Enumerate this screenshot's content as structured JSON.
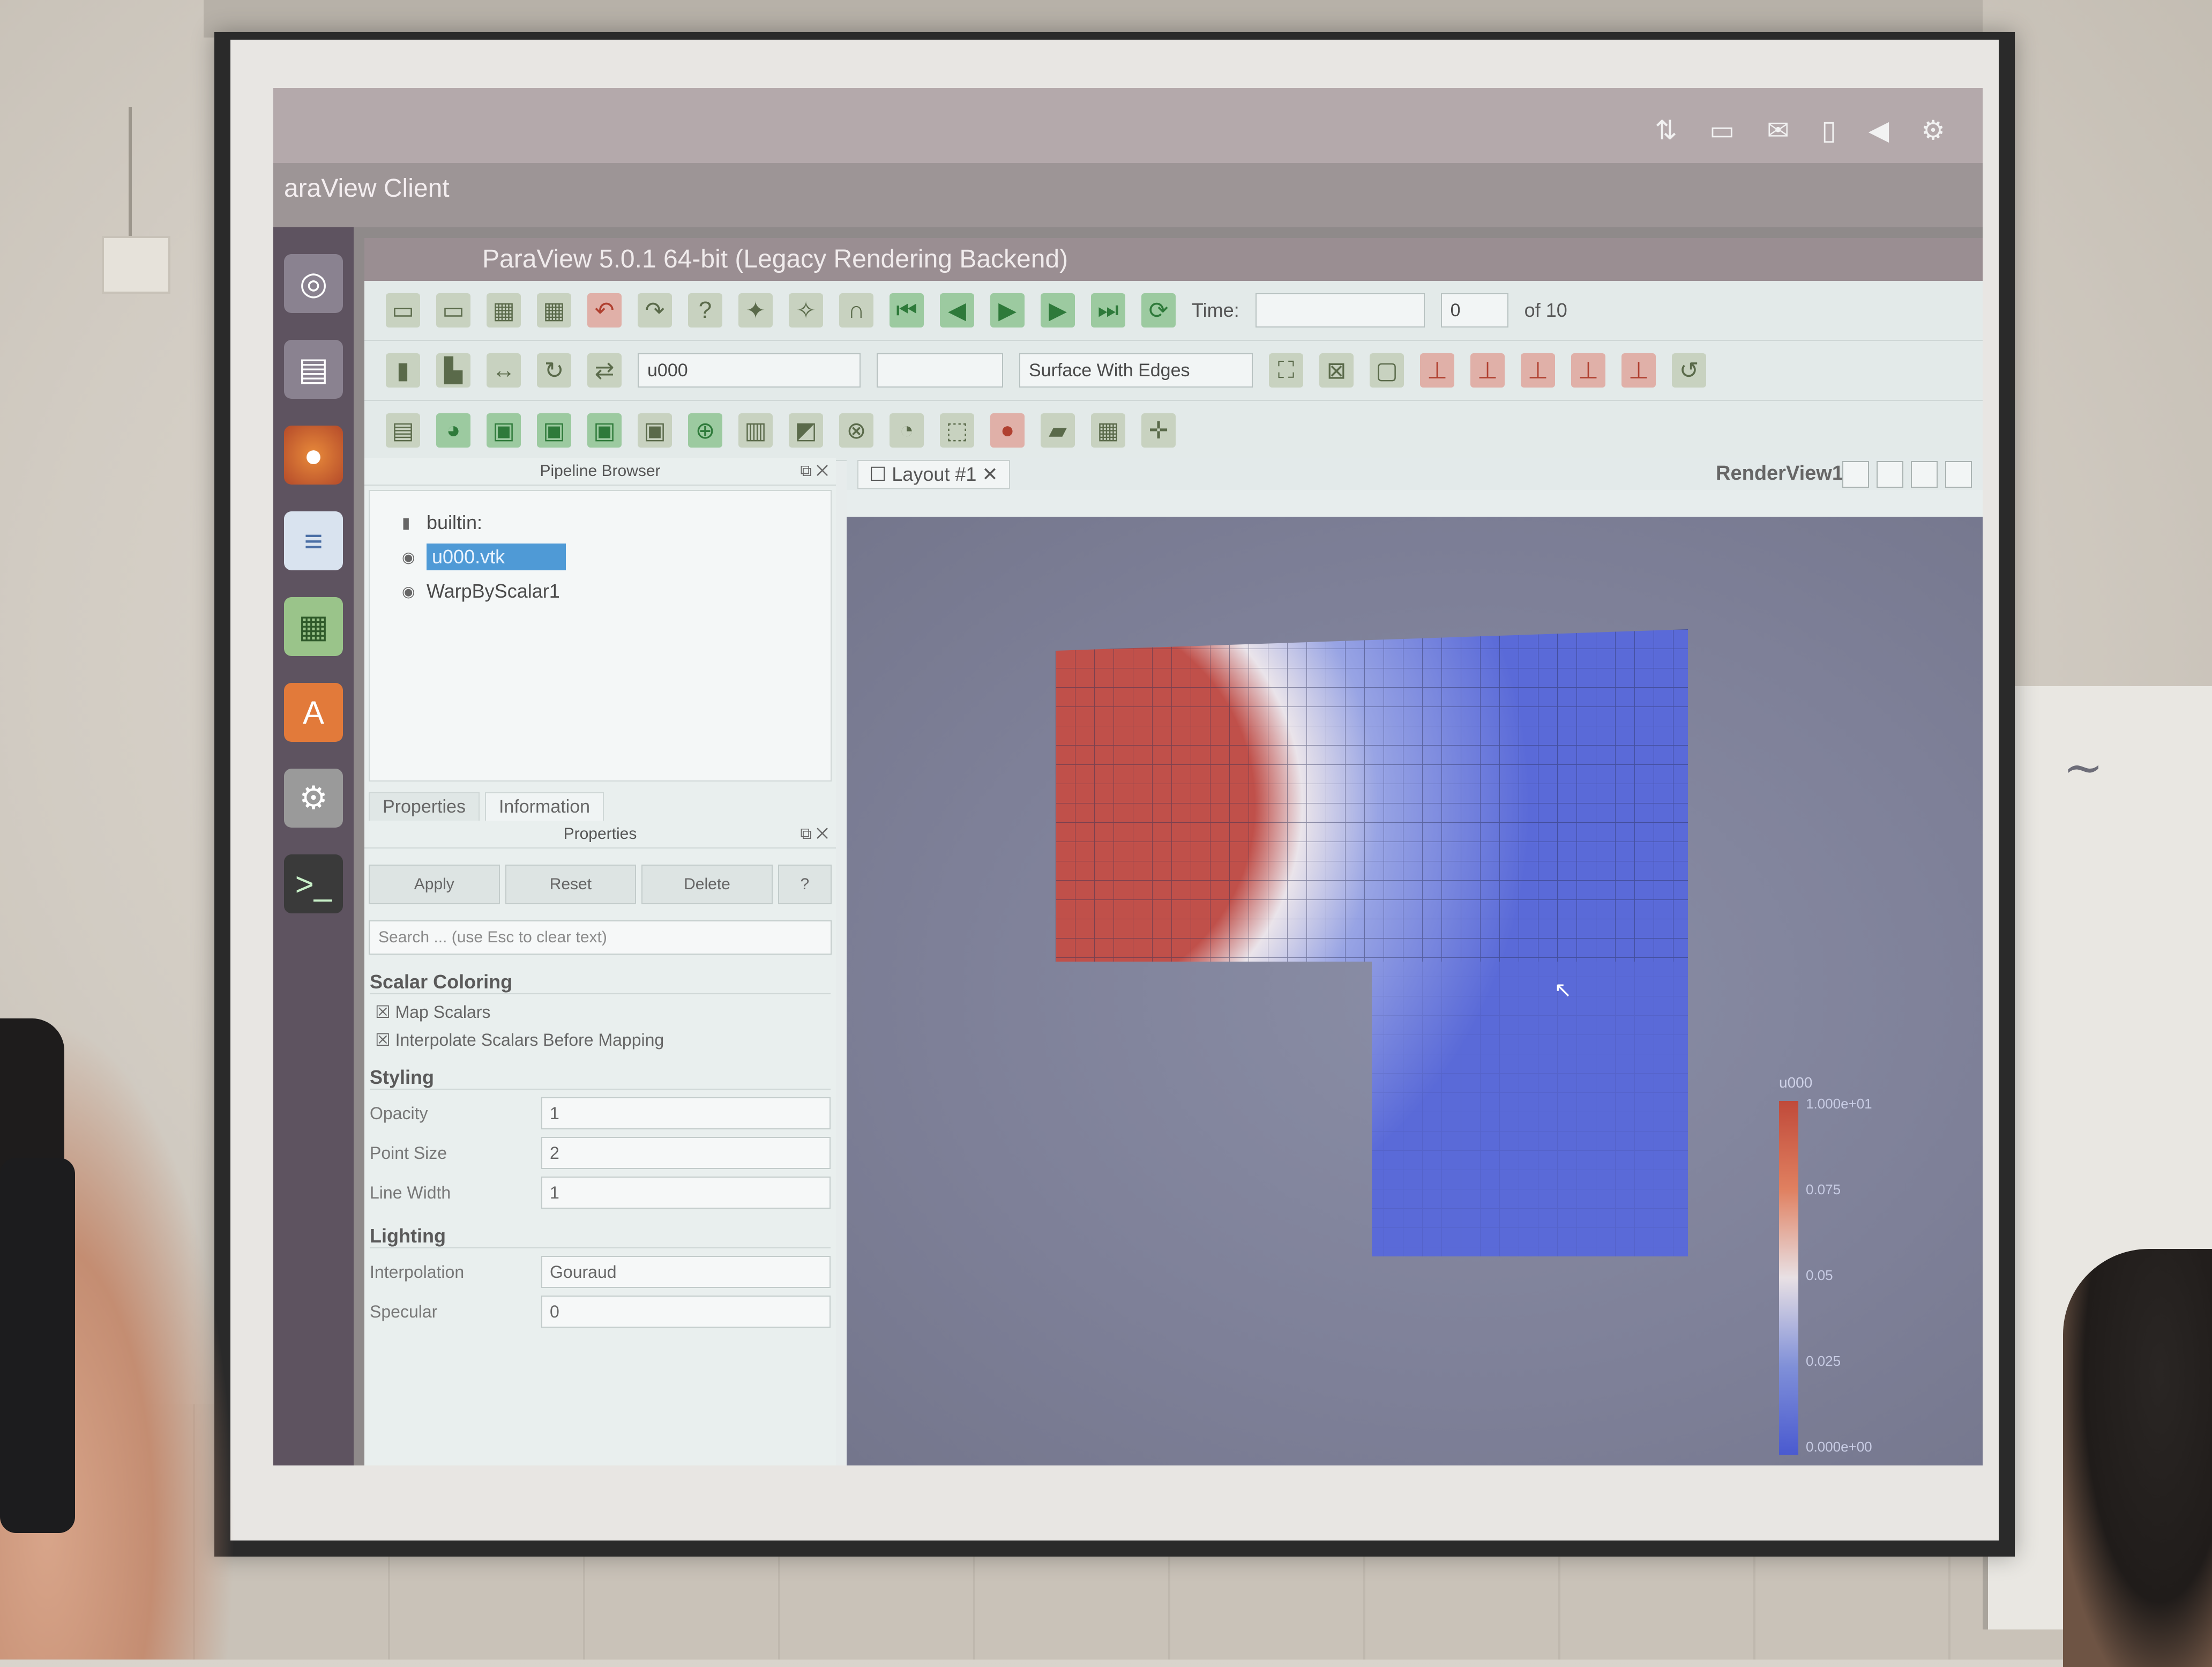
{
  "desktop": {
    "window_caption": "araView Client",
    "tray_icons": [
      "network-icon",
      "keyboard-icon",
      "mail-icon",
      "battery-icon",
      "volume-icon",
      "gear-icon"
    ]
  },
  "launcher": [
    "ubuntu-icon",
    "files-icon",
    "firefox-icon",
    "writer-icon",
    "calc-icon",
    "store-icon",
    "settings-icon",
    "terminal-icon"
  ],
  "paraview": {
    "title": "ParaView 5.0.1 64-bit (Legacy Rendering Backend)",
    "time_label": "Time:",
    "time_value": "0",
    "time_of": "of 10",
    "representation": "Surface With Edges",
    "color_by": "u000",
    "pipeline_title": "Pipeline Browser",
    "pipeline": [
      {
        "label": "builtin:",
        "selected": false
      },
      {
        "label": "u000.vtk",
        "selected": true
      },
      {
        "label": "WarpByScalar1",
        "selected": false
      }
    ],
    "tabs": [
      "Properties",
      "Information"
    ],
    "properties_title": "Properties",
    "buttons": [
      "Apply",
      "Reset",
      "Delete",
      "?"
    ],
    "search_placeholder": "Search ... (use Esc to clear text)",
    "sections": {
      "scalar_coloring": "Scalar Coloring",
      "map_scalars": "Map Scalars",
      "interpolate": "Interpolate Scalars Before Mapping",
      "styling": "Styling",
      "lighting": "Lighting"
    },
    "props": [
      {
        "label": "Opacity",
        "value": "1"
      },
      {
        "label": "Point Size",
        "value": "2"
      },
      {
        "label": "Line Width",
        "value": "1"
      }
    ],
    "lighting": [
      {
        "label": "Interpolation",
        "value": "Gouraud"
      },
      {
        "label": "Specular",
        "value": "0"
      }
    ],
    "layout_tab": "Layout #1",
    "render_view": "RenderView1",
    "legend": {
      "title": "u000",
      "ticks": [
        "1.000e+01",
        "0.075",
        "0.05",
        "0.025",
        "0.000e+00"
      ]
    },
    "colors": {
      "hot": "#c0504a",
      "cold": "#5a6ad8",
      "mid": "#eae4ea",
      "background": "#7e8098"
    }
  }
}
